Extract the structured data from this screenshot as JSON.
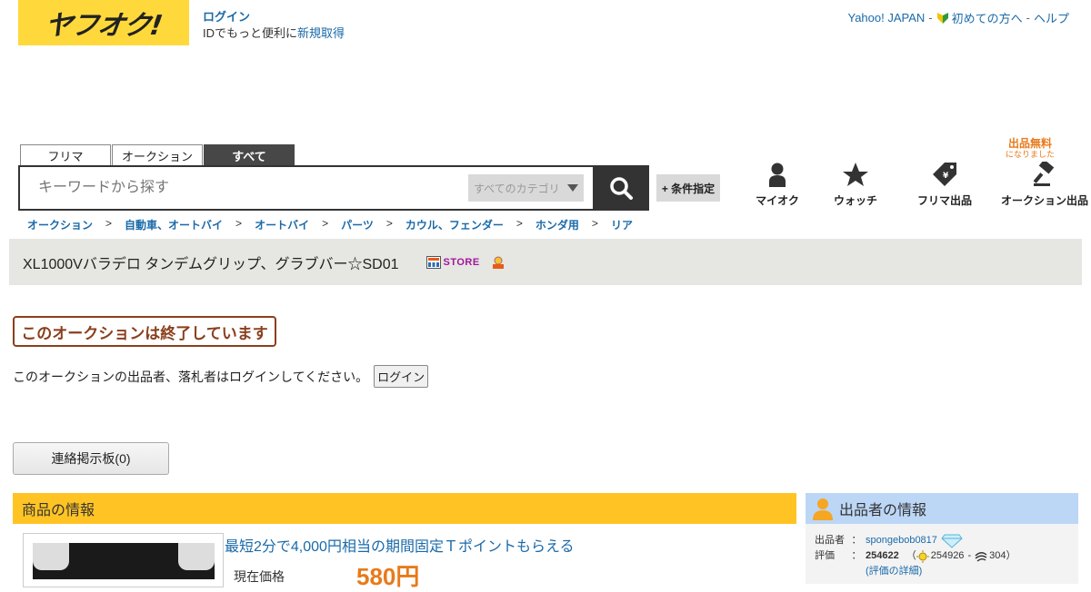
{
  "header": {
    "logo_text": "ヤフオク!",
    "login_link": "ログイン",
    "login_note": "IDでもっと便利に",
    "register_link": "新規取得",
    "top_links": {
      "yahoo": "Yahoo! JAPAN",
      "sep1": "-",
      "beginner": "初めての方へ",
      "sep2": "-",
      "help": "ヘルプ"
    }
  },
  "search": {
    "tabs": [
      {
        "label": "フリマ",
        "active": false
      },
      {
        "label": "オークション",
        "active": false
      },
      {
        "label": "すべて",
        "active": true
      }
    ],
    "placeholder": "キーワードから探す",
    "category": "すべてのカテゴリ",
    "condition_button": "+ 条件指定"
  },
  "nav": {
    "free_badge": "出品無料",
    "free_badge_sub": "になりました",
    "items": [
      {
        "label": "マイオク",
        "icon": "person-icon"
      },
      {
        "label": "ウォッチ",
        "icon": "star-icon"
      },
      {
        "label": "フリマ出品",
        "icon": "tag-icon"
      },
      {
        "label": "オークション出品",
        "icon": "gavel-icon"
      }
    ]
  },
  "breadcrumb": {
    "items": [
      "オークション",
      "自動車、オートバイ",
      "オートバイ",
      "パーツ",
      "カウル、フェンダー",
      "ホンダ用",
      "リア"
    ],
    "separator": ">"
  },
  "item": {
    "title": "XL1000Vバラデロ タンデムグリップ、グラブバー☆SD01",
    "store_label": "STORE"
  },
  "status": {
    "ended_text": "このオークションは終了しています",
    "login_note": "このオークションの出品者、落札者はログインしてください。",
    "login_button": "ログイン",
    "board_button": "連絡掲示板(0)"
  },
  "product": {
    "header": "商品の情報",
    "tpoint_link": "最短2分で4,000円相当の期間固定Ｔポイントもらえる",
    "price_label": "現在価格",
    "price_value": "580円"
  },
  "seller": {
    "header": "出品者の情報",
    "seller_key": "出品者",
    "colon": "：",
    "seller_name": "spongebob0817",
    "rating_key": "評価",
    "rating_score": "254622",
    "rating_open": "（",
    "good_count": "254926",
    "rating_dash": "-",
    "bad_count": "304",
    "rating_close": "）",
    "rating_detail": "(評価の詳細)"
  },
  "colors": {
    "brand_yellow": "#ffd93b",
    "product_header": "#ffc424",
    "seller_header": "#bcd6f6",
    "ended": "#8a3f1b",
    "price": "#e87a1a",
    "link": "#1a6aa9"
  }
}
